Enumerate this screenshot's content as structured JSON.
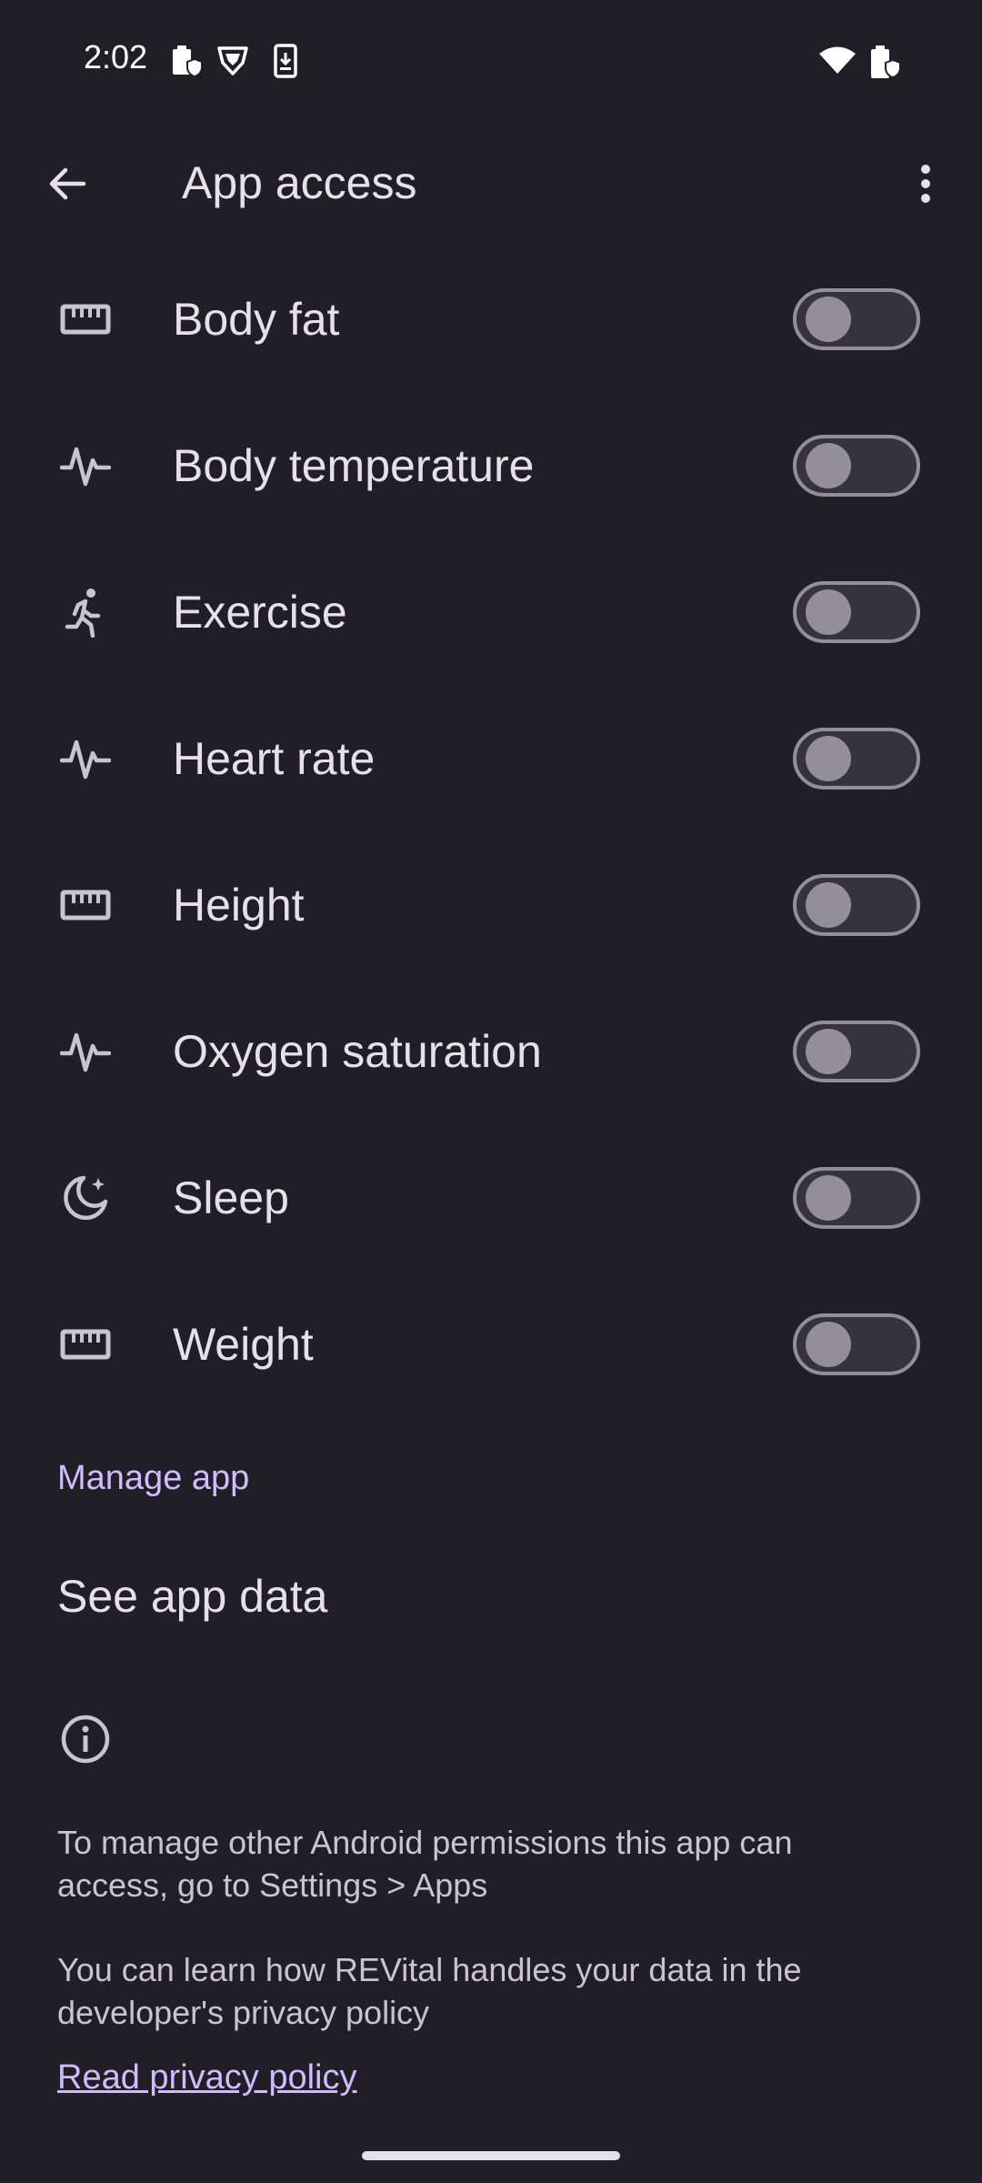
{
  "status_bar": {
    "time": "2:02"
  },
  "app_bar": {
    "title": "App access"
  },
  "permissions": [
    {
      "label": "Body fat",
      "icon": "ruler-icon",
      "enabled": false
    },
    {
      "label": "Body temperature",
      "icon": "vitals-icon",
      "enabled": false
    },
    {
      "label": "Exercise",
      "icon": "running-icon",
      "enabled": false
    },
    {
      "label": "Heart rate",
      "icon": "vitals-icon",
      "enabled": false
    },
    {
      "label": "Height",
      "icon": "ruler-icon",
      "enabled": false
    },
    {
      "label": "Oxygen saturation",
      "icon": "vitals-icon",
      "enabled": false
    },
    {
      "label": "Sleep",
      "icon": "sleep-moon-icon",
      "enabled": false
    },
    {
      "label": "Weight",
      "icon": "ruler-icon",
      "enabled": false
    }
  ],
  "manage_app": {
    "header": "Manage app",
    "see_app_data": "See app data"
  },
  "footer": {
    "permissions_note": "To manage other Android permissions this app can access, go to Settings > Apps",
    "privacy_note": "You can learn how REVital handles your data in the developer's privacy policy",
    "privacy_link": "Read privacy policy"
  },
  "colors": {
    "background": "#201f25",
    "accent": "#cfbcff",
    "switch_off_track": "#36343b",
    "switch_off_outline": "#938f99"
  }
}
